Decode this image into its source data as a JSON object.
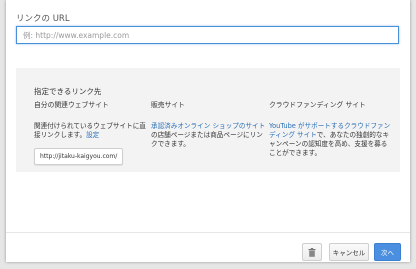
{
  "url_section": {
    "label": "リンクの URL",
    "placeholder": "例: http://www.example.com",
    "value": ""
  },
  "panel": {
    "title": "指定できるリンク先",
    "columns": [
      {
        "heading": "自分の関連ウェブサイト",
        "desc_plain": "関連付けられているウェブサイトに直接リンクします。",
        "desc_link": "設定",
        "example": "http://jitaku-kaigyou.com/"
      },
      {
        "heading": "販売サイト",
        "desc_link": "承認済みオンライン ショップのサイト",
        "desc_plain": "の店舗ページまたは商品ページにリンクできます。"
      },
      {
        "heading": "クラウドファンディング サイト",
        "desc_link": "YouTube がサポートするクラウドファンディング サイト",
        "desc_plain": "で、あなたの独創的なキャンペーンの認知度を高め、支援を募ることができます。"
      }
    ]
  },
  "footer": {
    "trash_icon": "trash-icon",
    "cancel_label": "キャンセル",
    "next_label": "次へ"
  },
  "colors": {
    "accent": "#4a8fe0",
    "link": "#2a6fb6",
    "panel_bg": "#f3f3f3"
  }
}
